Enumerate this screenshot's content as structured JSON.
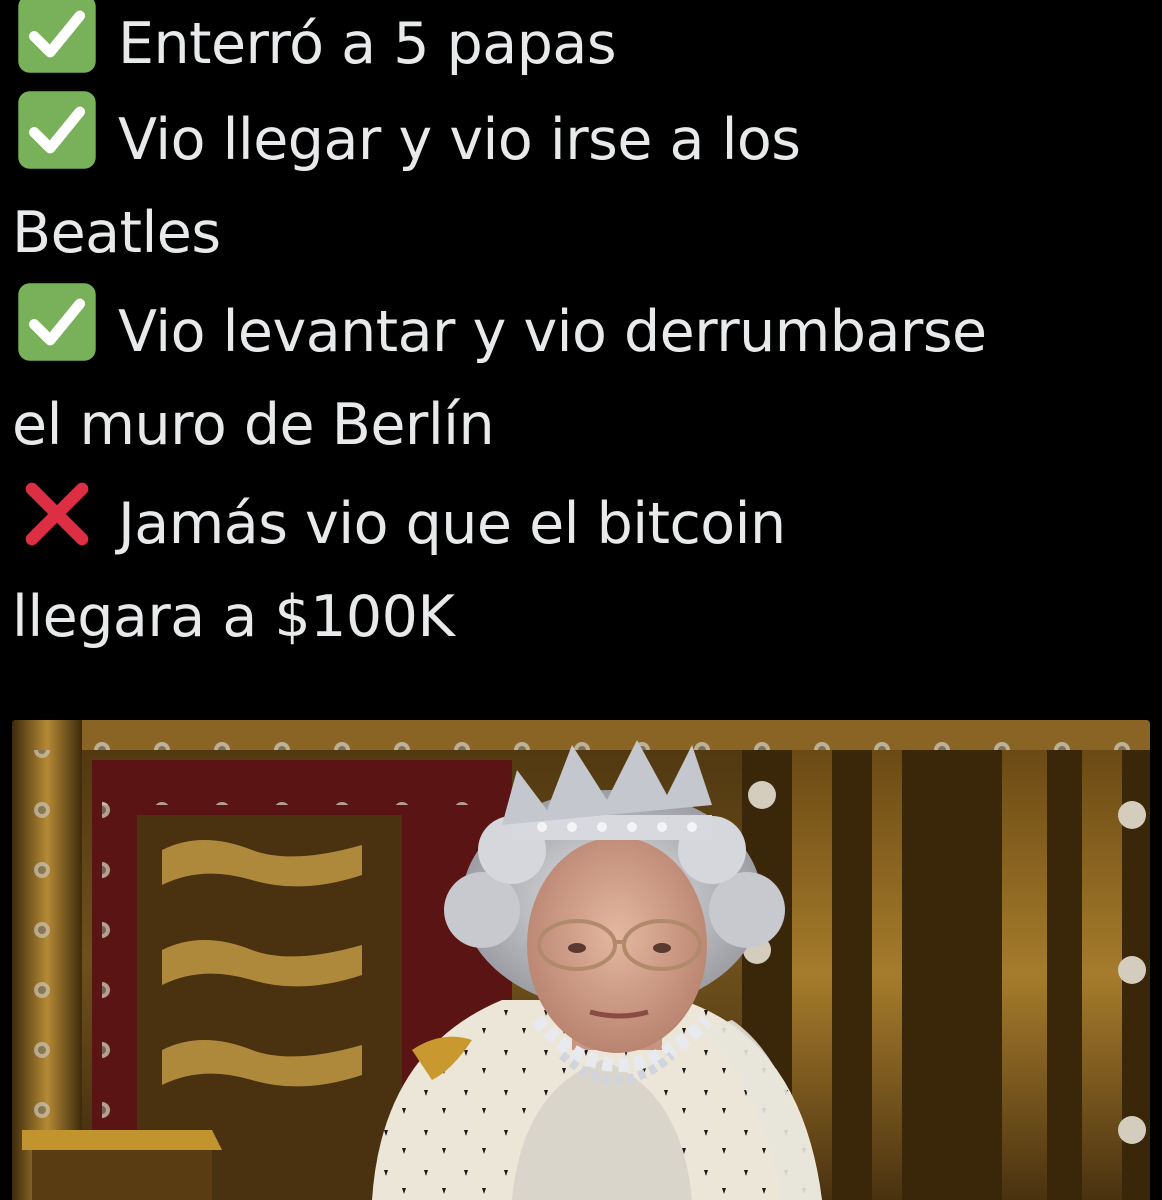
{
  "tweet": {
    "items": [
      {
        "icon": "check-mark-button-icon",
        "line1": "Enterró a 5 papas",
        "line2": ""
      },
      {
        "icon": "check-mark-button-icon",
        "line1": "Vio llegar y vio irse a los",
        "line2": "Beatles"
      },
      {
        "icon": "check-mark-button-icon",
        "line1": "Vio levantar y vio derrumbarse",
        "line2": "el muro de Berlín"
      },
      {
        "icon": "cross-mark-icon",
        "line1": "Jamás vio que el bitcoin",
        "line2": "llegara a $100K"
      }
    ]
  },
  "colors": {
    "background": "#000000",
    "text": "#e7e9ea",
    "check_green": "#78b159",
    "cross_red": "#dd2e44"
  }
}
